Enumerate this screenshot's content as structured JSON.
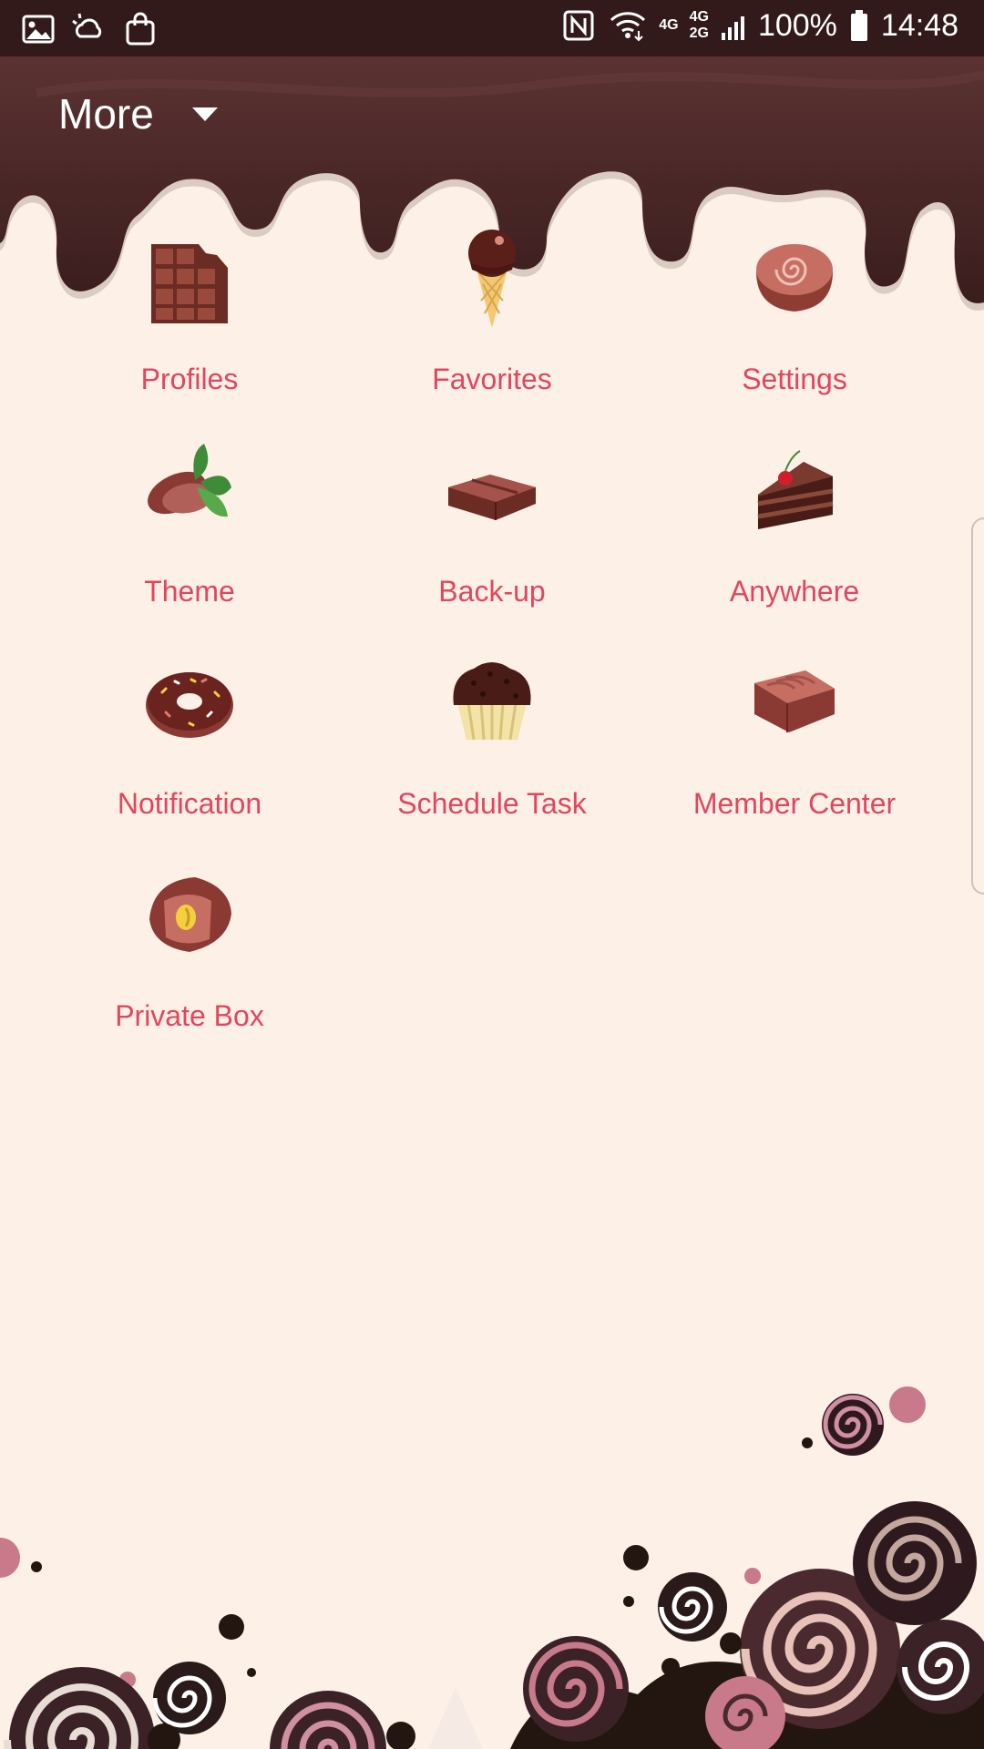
{
  "status_bar": {
    "left_icons": [
      "gallery-icon",
      "weather-icon",
      "shopping-bag-icon"
    ],
    "right_icons": [
      "nfc-icon",
      "wifi-icon",
      "signal-icon",
      "battery-icon"
    ],
    "network_1": "4G",
    "network_2_top": "4G",
    "network_2_bottom": "2G",
    "battery": "100%",
    "time": "14:48"
  },
  "app_bar": {
    "title": "More",
    "dropdown_icon": "caret-down-icon"
  },
  "menu": {
    "items": [
      {
        "label": "Profiles",
        "icon": "chocolate-bar-icon"
      },
      {
        "label": "Favorites",
        "icon": "ice-cream-cone-icon"
      },
      {
        "label": "Settings",
        "icon": "swirl-candy-icon"
      },
      {
        "label": "Theme",
        "icon": "cocoa-pod-icon"
      },
      {
        "label": "Back-up",
        "icon": "chocolate-block-icon"
      },
      {
        "label": "Anywhere",
        "icon": "cake-slice-icon"
      },
      {
        "label": "Notification",
        "icon": "donut-icon"
      },
      {
        "label": "Schedule Task",
        "icon": "muffin-icon"
      },
      {
        "label": "Member Center",
        "icon": "praline-icon"
      },
      {
        "label": "Private Box",
        "icon": "truffle-icon"
      }
    ]
  },
  "colors": {
    "background": "#fdf0e7",
    "status_bar": "#321a1a",
    "label": "#e0475c",
    "chocolate_dark": "#3b1f1f",
    "chocolate_mid": "#5a3030"
  }
}
